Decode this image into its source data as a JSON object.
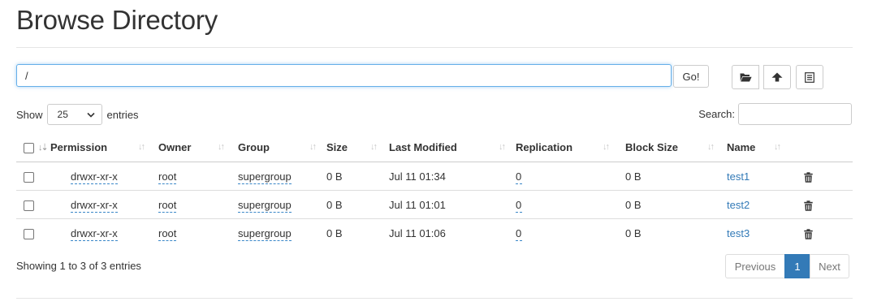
{
  "page": {
    "title": "Browse Directory"
  },
  "path_bar": {
    "value": "/",
    "go_label": "Go!"
  },
  "toolbar": {
    "buttons": [
      {
        "icon": "folder-open-icon"
      },
      {
        "icon": "upload-icon"
      },
      {
        "icon": "list-icon"
      }
    ]
  },
  "length_control": {
    "show_label": "Show",
    "selected": "25",
    "entries_label": "entries"
  },
  "search": {
    "label": "Search:",
    "value": ""
  },
  "table": {
    "columns": [
      "Permission",
      "Owner",
      "Group",
      "Size",
      "Last Modified",
      "Replication",
      "Block Size",
      "Name"
    ],
    "rows": [
      {
        "permission": "drwxr-xr-x",
        "owner": "root",
        "group": "supergroup",
        "size": "0 B",
        "modified": "Jul 11 01:34",
        "replication": "0",
        "block_size": "0 B",
        "name": "test1"
      },
      {
        "permission": "drwxr-xr-x",
        "owner": "root",
        "group": "supergroup",
        "size": "0 B",
        "modified": "Jul 11 01:01",
        "replication": "0",
        "block_size": "0 B",
        "name": "test2"
      },
      {
        "permission": "drwxr-xr-x",
        "owner": "root",
        "group": "supergroup",
        "size": "0 B",
        "modified": "Jul 11 01:06",
        "replication": "0",
        "block_size": "0 B",
        "name": "test3"
      }
    ]
  },
  "footer": {
    "info": "Showing 1 to 3 of 3 entries"
  },
  "pagination": {
    "previous": "Previous",
    "current": "1",
    "next": "Next"
  },
  "colors": {
    "link": "#337ab7",
    "focus_border": "#66afe9",
    "active_page": "#337ab7"
  }
}
